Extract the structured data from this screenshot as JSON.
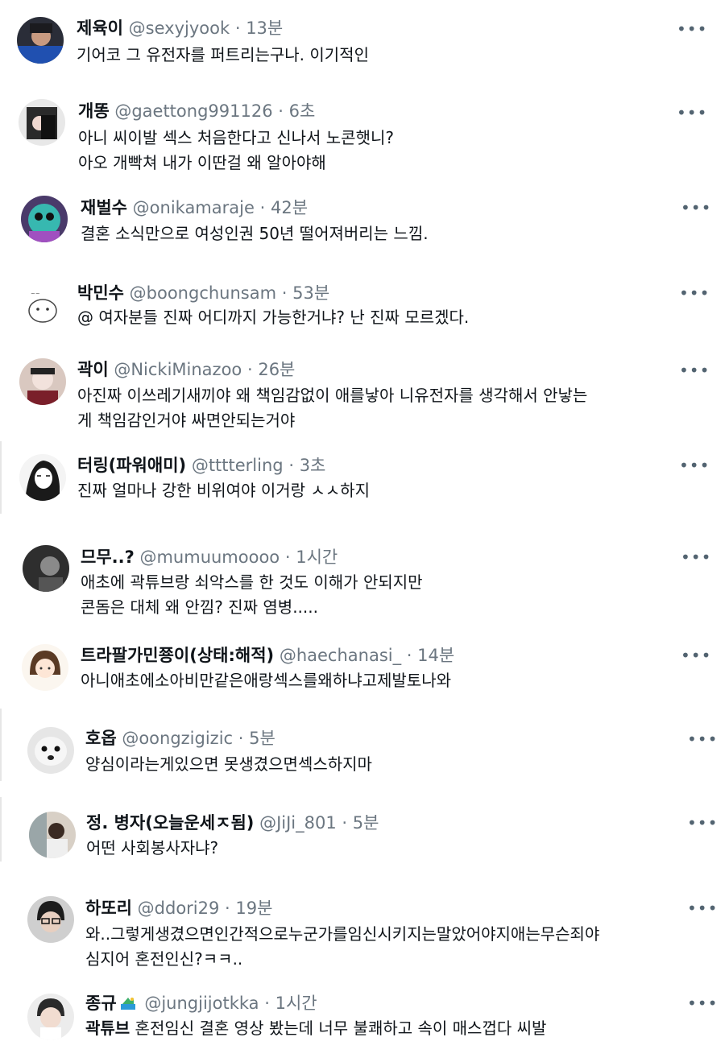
{
  "tweets": [
    {
      "name": "제육이",
      "handle": "@sexyjyook",
      "time": "13분",
      "lines": [
        "기어코 그 유전자를 퍼트리는구나. 이기적인"
      ]
    },
    {
      "name": "개똥",
      "handle": "@gaettong991126",
      "time": "6초",
      "lines": [
        "아니 씨이발 섹스 처음한다고 신나서 노콘햇니?",
        "아오 개빡쳐 내가 이딴걸 왜 알아야해"
      ]
    },
    {
      "name": "재벌수",
      "handle": "@onikamaraje",
      "time": "42분",
      "lines": [
        "결혼 소식만으로 여성인권 50년 떨어져버리는 느낌."
      ]
    },
    {
      "name": "박민수",
      "handle": "@boongchunsam",
      "time": "53분",
      "lines": [
        "@ 여자분들 진짜 어디까지 가능한거냐? 난 진짜 모르겠다."
      ]
    },
    {
      "name": "곽이",
      "handle": "@NickiMinazoo",
      "time": "26분",
      "lines": [
        "아진짜 이쓰레기새끼야 왜 책임감없이 애를낳아 니유전자를 생각해서 안낳는",
        "게 책임감인거야 싸면안되는거야"
      ]
    },
    {
      "name": "터링(파워애미)",
      "handle": "@tttterling",
      "time": "3초",
      "lines": [
        "진짜 얼마나 강한 비위여야 이거랑 ㅅㅅ하지"
      ]
    },
    {
      "name": "므무..?",
      "handle": "@mumuumoooo",
      "time": "1시간",
      "lines": [
        "애초에 곽튜브랑 쇠악스를 한 것도 이해가 안되지만",
        "콘돔은 대체 왜 안낌? 진짜 염병....."
      ]
    },
    {
      "name": "트라팔가민쭁이(상태:해적)",
      "handle": "@haechanasi_",
      "time": "14분",
      "lines": [
        "아니애초에소아비만같은애랑섹스를왜하냐고제발토나와"
      ]
    },
    {
      "name": "호옵",
      "handle": "@oongzigizic",
      "time": "5분",
      "lines": [
        "양심이라는게있으면 못생겼으면섹스하지마"
      ]
    },
    {
      "name": "정. 병자(오늘운세ㅈ됨)",
      "handle": "@JiJi_801",
      "time": "5분",
      "lines": [
        "어떤 사회봉사자냐?"
      ]
    },
    {
      "name": "하또리",
      "handle": "@ddori29",
      "time": "19분",
      "lines": [
        "와..그렇게생겼으면인간적으로누군가를임신시키지는말았어야지애는무슨죄야",
        "심지어 혼전인신?ㅋㅋ.."
      ]
    },
    {
      "name": "종규",
      "handle": "@jungjijotkka",
      "time": "1시간",
      "lines_rich": [
        {
          "strong": "곽튜브",
          "rest": " 혼전임신 결혼 영상 봤는데 너무 불쾌하고 속이 매스껍다 씨발"
        }
      ]
    }
  ],
  "more_glyph": "•••",
  "sep": "·",
  "icons": {
    "more": "more-options-icon",
    "badge": "emoji-badge-icon"
  },
  "colors": {
    "text": "#0f1419",
    "meta": "#6b7680",
    "more": "#536471"
  }
}
